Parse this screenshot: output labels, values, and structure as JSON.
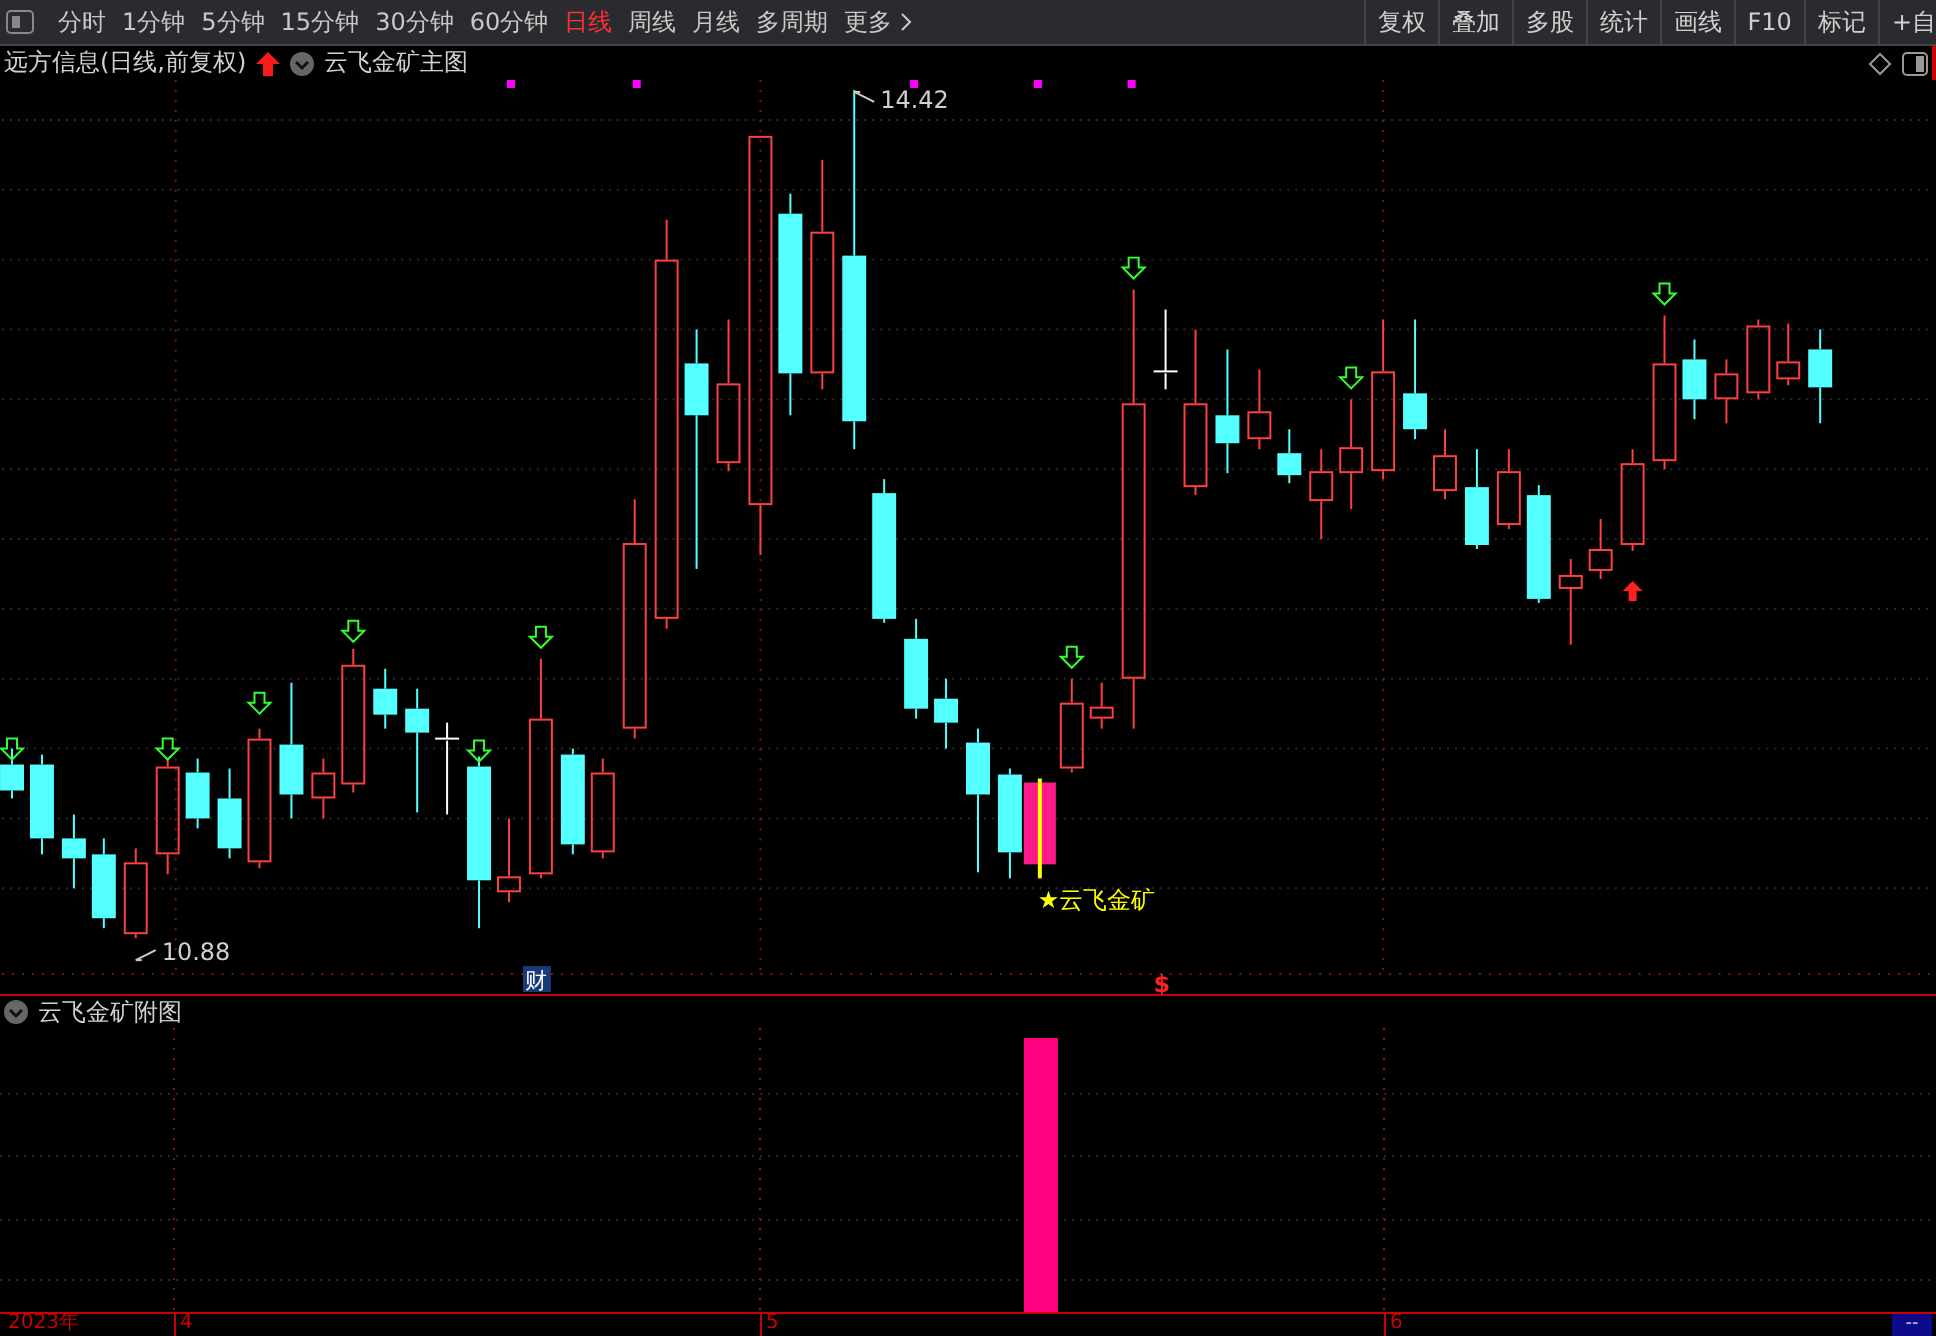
{
  "toolbar": {
    "periods": [
      {
        "label": "分时",
        "selected": false
      },
      {
        "label": "1分钟",
        "selected": false
      },
      {
        "label": "5分钟",
        "selected": false
      },
      {
        "label": "15分钟",
        "selected": false
      },
      {
        "label": "30分钟",
        "selected": false
      },
      {
        "label": "60分钟",
        "selected": false
      },
      {
        "label": "日线",
        "selected": true
      },
      {
        "label": "周线",
        "selected": false
      },
      {
        "label": "月线",
        "selected": false
      },
      {
        "label": "多周期",
        "selected": false
      },
      {
        "label": "更多",
        "selected": false
      }
    ],
    "buttons": [
      "复权",
      "叠加",
      "多股",
      "统计",
      "画线",
      "F10",
      "标记",
      "+自"
    ]
  },
  "main_chart": {
    "title": "远方信息(日线,前复权)",
    "indicator": "云飞金矿主图",
    "high_label": "14.42",
    "low_label": "10.88",
    "signal_label": "★云飞金矿",
    "event_markers": [
      "财",
      "$"
    ]
  },
  "sub_chart": {
    "title": "云飞金矿附图"
  },
  "time_axis": {
    "labels": [
      "2023年",
      "4",
      "5",
      "6"
    ],
    "corner": "--"
  }
}
